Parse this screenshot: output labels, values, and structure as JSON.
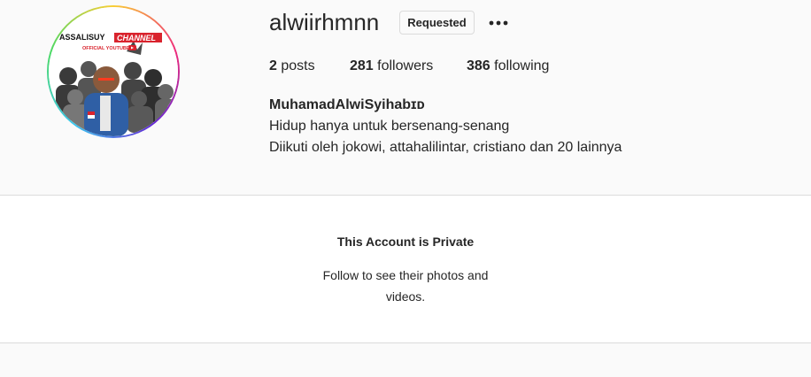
{
  "profile": {
    "username": "alwiirhmnn",
    "follow_button_label": "Requested",
    "more_icon": "more-dots-icon",
    "avatar_banner_line1": "ASSALISUY",
    "avatar_banner_line1b": "CHANNEL",
    "avatar_banner_line2": "OFFICIAL YOUTUBE"
  },
  "stats": {
    "posts_count": "2",
    "posts_label": "posts",
    "followers_count": "281",
    "followers_label": "followers",
    "following_count": "386",
    "following_label": "following"
  },
  "bio": {
    "full_name": "MuhamadAlwiSyihabɪᴅ",
    "text": "Hidup hanya untuk bersenang-senang",
    "followed_by": "Diikuti oleh jokowi, attahalilintar, cristiano dan 20 lainnya"
  },
  "private_notice": {
    "title": "This Account is Private",
    "subtitle": "Follow to see their photos and videos."
  },
  "colors": {
    "background": "#fafafa",
    "border": "#dbdbdb",
    "text": "#262626",
    "banner_red": "#d9232d"
  }
}
